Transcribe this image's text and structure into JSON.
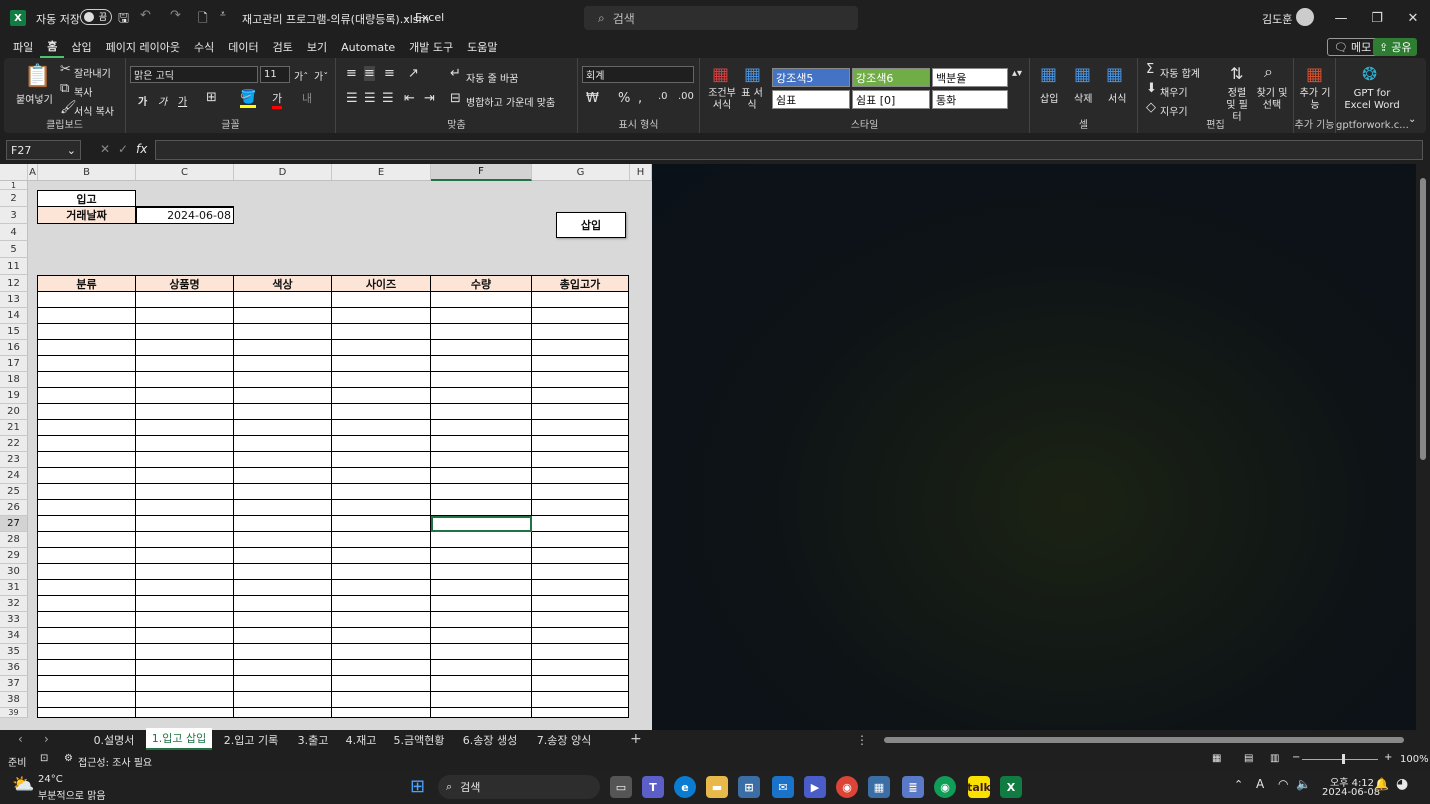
{
  "app": {
    "autosave_label": "자동 저장",
    "autosave_state": "끔",
    "file_title": "재고관리 프로그램-의류(대량등록).xlsm",
    "app_name": "Excel",
    "search_placeholder": "검색",
    "user_name": "김도훈"
  },
  "menu": {
    "items": [
      "파일",
      "홈",
      "삽입",
      "페이지 레이아웃",
      "수식",
      "데이터",
      "검토",
      "보기",
      "Automate",
      "개발 도구",
      "도움말"
    ],
    "active": "홈",
    "memo": "메모",
    "share": "공유"
  },
  "ribbon": {
    "clipboard": {
      "paste": "붙여넣기",
      "cut": "잘라내기",
      "copy": "복사",
      "format_painter": "서식 복사",
      "label": "클립보드"
    },
    "font": {
      "name": "맑은 고딕",
      "size": "11",
      "grow": "가ˆ",
      "shrink": "가ˇ",
      "bold": "가",
      "italic": "가",
      "underline": "가",
      "label": "글꼴"
    },
    "align": {
      "wrap": "자동 줄 바꿈",
      "merge": "병합하고 가운데 맞춤",
      "label": "맞춤"
    },
    "number": {
      "format": "회계",
      "label": "표시 형식"
    },
    "styles": {
      "cond_format": "조건부 서식",
      "table_format": "표 서식",
      "cells": [
        "강조색5",
        "강조색6",
        "백분율",
        "쉼표",
        "쉼표 [0]",
        "통화"
      ],
      "colors": {
        "accent5": "#4472c4",
        "accent6": "#70ad47"
      },
      "label": "스타일"
    },
    "cells": {
      "insert": "삽입",
      "delete": "삭제",
      "format": "서식",
      "label": "셀"
    },
    "editing": {
      "autosum": "자동 합계",
      "fill": "채우기",
      "clear": "지우기",
      "sort": "정렬 및 필터",
      "find": "찾기 및 선택",
      "label": "편집"
    },
    "addins": {
      "addin": "추가 기능",
      "gpt": "GPT for Excel Word",
      "label": "추가 기능",
      "gpt_label": "gptforwork.c..."
    }
  },
  "formula": {
    "name_box": "F27",
    "fx": "fx",
    "value": ""
  },
  "sheet": {
    "columns": [
      "A",
      "B",
      "C",
      "D",
      "E",
      "F",
      "G",
      "H"
    ],
    "selected_column": "F",
    "rows": [
      "1",
      "2",
      "3",
      "4",
      "5",
      "11",
      "12",
      "13",
      "14",
      "15",
      "16",
      "17",
      "18",
      "19",
      "20",
      "21",
      "22",
      "23",
      "24",
      "25",
      "26",
      "27",
      "28",
      "29",
      "30",
      "31",
      "32",
      "33",
      "34",
      "35",
      "36",
      "37",
      "38",
      "39"
    ],
    "selected_row": "27",
    "title_cell": "입고",
    "date_label": "거래날짜",
    "date_value": "2024-06-08",
    "insert_button": "삽입",
    "table_headers": [
      "분류",
      "상품명",
      "색상",
      "사이즈",
      "수량",
      "총입고가"
    ],
    "header_fill": "#fce4d6"
  },
  "tabs": {
    "items": [
      "0.설명서",
      "1.입고 삽입",
      "2.입고 기록",
      "3.출고",
      "4.재고",
      "5.금액현황",
      "6.송장 생성",
      "7.송장 양식"
    ],
    "active": "1.입고 삽입"
  },
  "status": {
    "ready": "준비",
    "accessibility": "접근성: 조사 필요",
    "zoom": "100%"
  },
  "taskbar": {
    "weather_temp": "24°C",
    "weather_desc": "부분적으로 맑음",
    "search": "검색",
    "time": "오후 4:12",
    "date": "2024-06-08"
  }
}
